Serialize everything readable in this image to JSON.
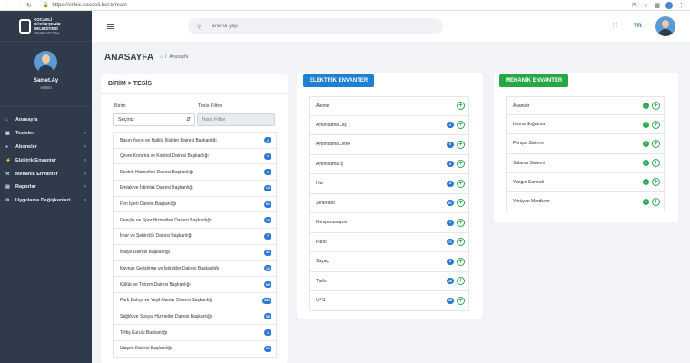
{
  "browser": {
    "url": "https://enbis.kocaeli.bel.tr/main"
  },
  "sidebar": {
    "logo": {
      "line1": "KOCAELİ",
      "line2": "BÜYÜKŞEHİR",
      "line3": "BELEDİYESİ",
      "line4": "KOCAELI CITY HALL"
    },
    "profile": {
      "name": "Samet.Ay",
      "role": "Admin"
    },
    "items": [
      {
        "label": "Anasayfa",
        "icon": "home-icon",
        "chevron": false
      },
      {
        "label": "Tesisler",
        "icon": "building-icon",
        "chevron": true
      },
      {
        "label": "Aboneler",
        "icon": "users-icon",
        "chevron": true
      },
      {
        "label": "Elektrik Envanter",
        "icon": "bolt-icon",
        "chevron": true
      },
      {
        "label": "Mekanik Envanter",
        "icon": "wrench-icon",
        "chevron": true
      },
      {
        "label": "Raporlar",
        "icon": "chart-icon",
        "chevron": true
      },
      {
        "label": "Uygulama Değişkenleri",
        "icon": "settings-icon",
        "chevron": true
      }
    ]
  },
  "topbar": {
    "search_placeholder": "arama yap",
    "lang": "TR"
  },
  "page": {
    "title": "ANASAYFA",
    "breadcrumb": "Anasayfa"
  },
  "birim": {
    "title": "BİRİM > TESİS",
    "birim_label": "Birim",
    "tesis_filter_label": "Tesis Filtre",
    "select_value": "Seçiniz",
    "filter_placeholder": "Tesis Filtre",
    "items": [
      {
        "label": "Basın Yayın ve Halkla İlişkiler Dairesi Başkanlığı",
        "count": "2"
      },
      {
        "label": "Çevre Koruma ve Kontrol Dairesi Başkanlığı",
        "count": "1"
      },
      {
        "label": "Destek Hizmetleri Dairesi Başkanlığı",
        "count": "2"
      },
      {
        "label": "Emlak ve İstimlak Dairesi Başkanlığı",
        "count": "14"
      },
      {
        "label": "Fen İşleri Dairesi Başkanlığı",
        "count": "51"
      },
      {
        "label": "Gençlik ve Spor Hizmetleri Dairesi Başkanlığı",
        "count": "19"
      },
      {
        "label": "İmar ve Şehircilik Dairesi Başkanlığı",
        "count": "7"
      },
      {
        "label": "İtfaiye Dairesi Başkanlığı",
        "count": "41"
      },
      {
        "label": "Kaynak Geliştirme ve İştirakler Dairesi Başkanlığı",
        "count": "13"
      },
      {
        "label": "Kültür ve Turizm Dairesi Başkanlığı",
        "count": "69"
      },
      {
        "label": "Park Bahçe ve Yeşil Alanlar Dairesi Başkanlığı",
        "count": "381"
      },
      {
        "label": "Sağlık ve Sosyal Hizmetler Dairesi Başkanlığı",
        "count": "55"
      },
      {
        "label": "Teftiş Kurulu Başkanlığı",
        "count": "1"
      },
      {
        "label": "Ulaşım Dairesi Başkanlığı",
        "count": "31"
      }
    ]
  },
  "elektrik": {
    "title": "ELEKTRİK ENVANTER",
    "items": [
      {
        "label": "Abone",
        "count": ""
      },
      {
        "label": "Aydınlatma Dış",
        "count": "2"
      },
      {
        "label": "Aydınlatma Direk",
        "count": "6"
      },
      {
        "label": "Aydınlatma İç",
        "count": "8"
      },
      {
        "label": "Hat",
        "count": "8"
      },
      {
        "label": "Jeneratör",
        "count": "61"
      },
      {
        "label": "Kompanzasyon",
        "count": "1"
      },
      {
        "label": "Pano",
        "count": "71"
      },
      {
        "label": "Sayaç",
        "count": "8"
      },
      {
        "label": "Trafo",
        "count": "28"
      },
      {
        "label": "UPS",
        "count": "58"
      }
    ]
  },
  "mekanik": {
    "title": "MEKANİK ENVANTER",
    "items": [
      {
        "label": "Asansör",
        "count": "1"
      },
      {
        "label": "Isıtma Soğutma",
        "count": "5"
      },
      {
        "label": "Pompa Sistemi",
        "count": "8"
      },
      {
        "label": "Sulama Sistemi",
        "count": "8"
      },
      {
        "label": "Yangın Santrali",
        "count": "2"
      },
      {
        "label": "Yürüyen Merdiven",
        "count": "8"
      }
    ]
  },
  "colors": {
    "sidebar": "#2f3a4a",
    "primary": "#1f7fd1",
    "success": "#28a745"
  }
}
